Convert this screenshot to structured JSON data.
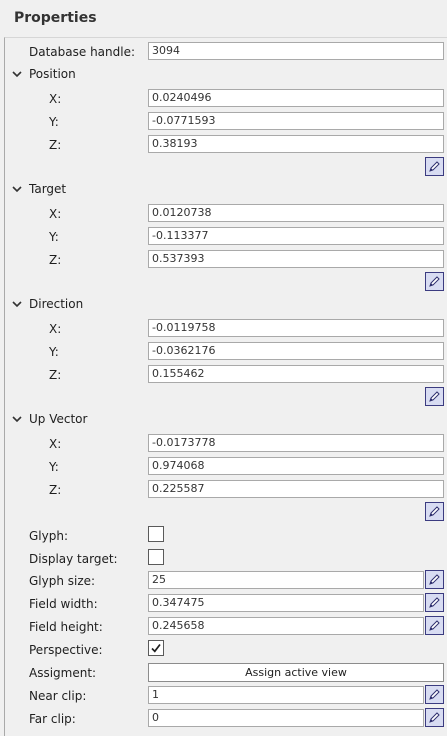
{
  "header": {
    "title": "Properties"
  },
  "database_handle": {
    "label": "Database handle:",
    "value": "3094"
  },
  "sections": [
    {
      "name": "Position",
      "x": "0.0240496",
      "y": "-0.0771593",
      "z": "0.38193"
    },
    {
      "name": "Target",
      "x": "0.0120738",
      "y": "-0.113377",
      "z": "0.537393"
    },
    {
      "name": "Direction",
      "x": "-0.0119758",
      "y": "-0.0362176",
      "z": "0.155462"
    },
    {
      "name": "Up Vector",
      "x": "-0.0173778",
      "y": "0.974068",
      "z": "0.225587"
    }
  ],
  "axis_labels": {
    "x": "X:",
    "y": "Y:",
    "z": "Z:"
  },
  "options": {
    "glyph": {
      "label": "Glyph:",
      "checked": false
    },
    "display_target": {
      "label": "Display target:",
      "checked": false
    },
    "glyph_size": {
      "label": "Glyph size:",
      "value": "25"
    },
    "field_width": {
      "label": "Field width:",
      "value": "0.347475"
    },
    "field_height": {
      "label": "Field height:",
      "value": "0.245658"
    },
    "perspective": {
      "label": "Perspective:",
      "checked": true,
      "check_glyph": "✓"
    },
    "assignment": {
      "label": "Assigment:",
      "button_label": "Assign active view"
    },
    "near_clip": {
      "label": "Near clip:",
      "value": "1"
    },
    "far_clip": {
      "label": "Far clip:",
      "value": "0"
    }
  },
  "icons": {
    "expand": "chevron-down-icon",
    "edit": "pencil-edit-icon"
  },
  "colors": {
    "background": "#f0f0f0",
    "field_border": "#a9a9a9",
    "edit_button_border": "#3b3b80",
    "edit_button_fill": "#d8dcf2"
  }
}
